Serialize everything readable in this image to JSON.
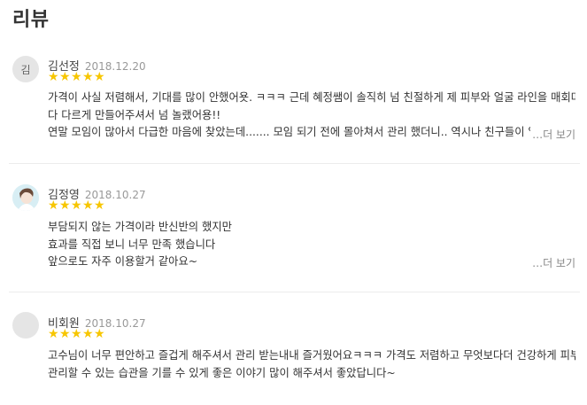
{
  "section_title": "리뷰",
  "stars_glyph": "★",
  "star_color": "#f7c600",
  "reviews": [
    {
      "avatar": "김",
      "name": "김선정",
      "date": "2018.12.20",
      "rating": 5,
      "lines": [
        "가격이 사실 저렴해서, 기대를 많이 안했어욧. ㅋㅋㅋ 근데 혜정쌤이 솔직히 넘 친절하게 제 피부와 얼굴 라인을 매회마",
        "다 다르게 만들어주셔서 넘 놀랬어용!!",
        "연말 모임이 많아서 다급한 마음에 찾았는데....... 모임 되기 전에 몰아쳐서 관리 했더니.. 역시나 친구들이 얼굴"
      ],
      "more": "…더 보기"
    },
    {
      "avatar": "",
      "name": "김정영",
      "date": "2018.10.27",
      "rating": 5,
      "lines": [
        "부담되지 않는 가격이라 반신반의 했지만",
        "효과를 직접 보니 너무 만족 했습니다",
        "앞으로도 자주 이용할거 같아요~"
      ],
      "more": "…더 보기"
    },
    {
      "avatar": "",
      "name": "비회원",
      "date": "2018.10.27",
      "rating": 5,
      "lines": [
        "고수님이 너무 편안하고 즐겁게 해주셔서 관리 받는내내 즐거웠어요ㅋㅋㅋ 가격도 저렴하고 무엇보다더 건강하게 피부",
        "관리할 수 있는 습관을 기를 수 있게 좋은 이야기 많이 해주셔서 좋았답니다~"
      ]
    }
  ]
}
